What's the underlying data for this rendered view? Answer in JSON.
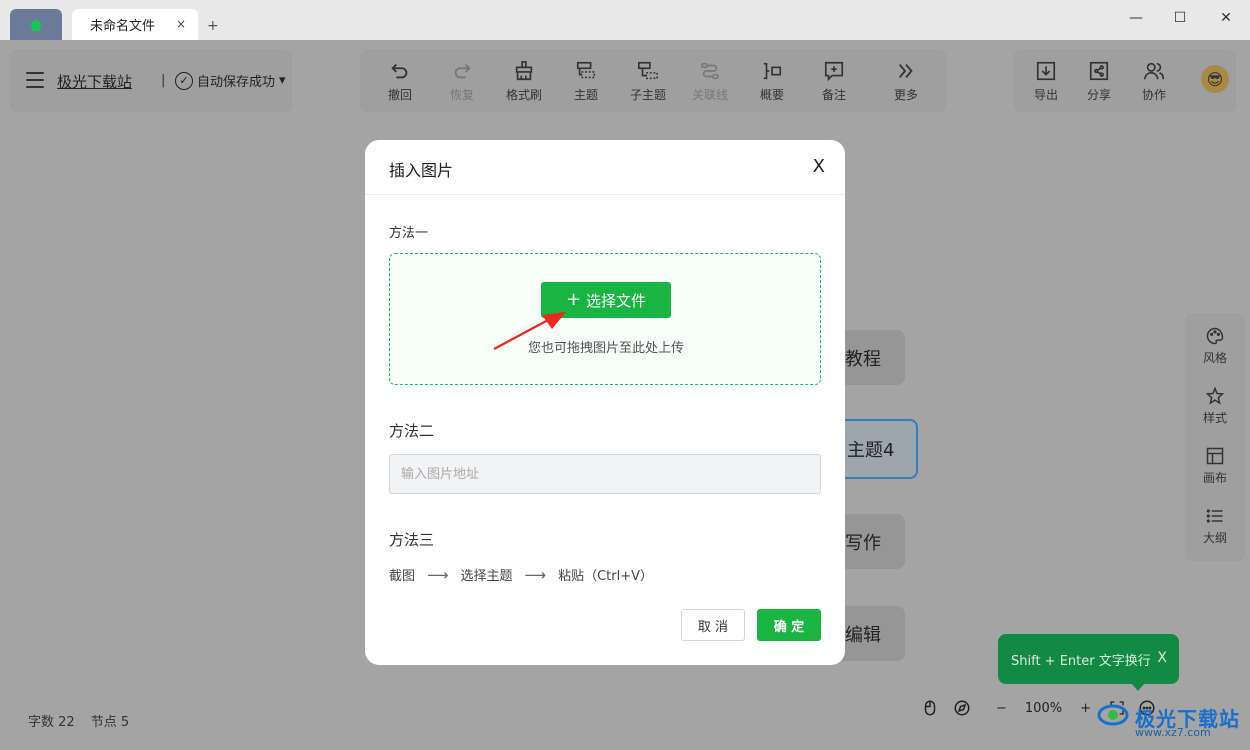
{
  "tabs": {
    "file_tab_label": "未命名文件",
    "close_glyph": "×",
    "new_tab_glyph": "+"
  },
  "window_controls": {
    "minimize": "—",
    "maximize": "☐",
    "close": "✕"
  },
  "header": {
    "site_name": "极光下载站",
    "separator": "|",
    "save_status": "自动保存成功",
    "save_status_dropdown": "▾"
  },
  "toolbar": {
    "items": [
      {
        "label": "撤回",
        "icon": "undo-icon",
        "enabled": true
      },
      {
        "label": "恢复",
        "icon": "redo-icon",
        "enabled": false
      },
      {
        "label": "格式刷",
        "icon": "format-brush-icon",
        "enabled": true
      },
      {
        "label": "主题",
        "icon": "topic-icon",
        "enabled": true
      },
      {
        "label": "子主题",
        "icon": "subtopic-icon",
        "enabled": true
      },
      {
        "label": "关联线",
        "icon": "relation-line-icon",
        "enabled": false
      },
      {
        "label": "概要",
        "icon": "summary-icon",
        "enabled": true
      },
      {
        "label": "备注",
        "icon": "note-icon",
        "enabled": true
      },
      {
        "label": "更多",
        "icon": "more-icon",
        "enabled": true
      }
    ]
  },
  "right_actions": {
    "items": [
      {
        "label": "导出",
        "icon": "export-icon"
      },
      {
        "label": "分享",
        "icon": "share-icon"
      },
      {
        "label": "协作",
        "icon": "collaborate-icon"
      }
    ],
    "avatar": "😎"
  },
  "side_panel": {
    "items": [
      {
        "label": "风格",
        "icon": "palette-icon"
      },
      {
        "label": "样式",
        "icon": "style-icon"
      },
      {
        "label": "画布",
        "icon": "canvas-icon"
      },
      {
        "label": "大纲",
        "icon": "outline-icon"
      }
    ]
  },
  "canvas_nodes": [
    {
      "text": "教程"
    },
    {
      "text": "主题4",
      "selected": true
    },
    {
      "text": "写作"
    },
    {
      "text": "编辑"
    }
  ],
  "tooltip": {
    "text": "Shift + Enter 文字换行",
    "close": "X"
  },
  "status": {
    "word_count_label": "字数",
    "word_count": "22",
    "node_count_label": "节点",
    "node_count": "5"
  },
  "zoom": {
    "minus": "−",
    "level": "100%",
    "plus": "+"
  },
  "watermark": {
    "text": "极光下载站",
    "url": "www.xz7.com"
  },
  "dialog": {
    "title": "插入图片",
    "close": "X",
    "method1": "方法一",
    "choose_file_label": "选择文件",
    "drop_hint": "您也可拖拽图片至此处上传",
    "method2": "方法二",
    "url_placeholder": "输入图片地址",
    "url_value": "",
    "method3": "方法三",
    "steps": [
      "截图",
      "选择主题",
      "粘贴（Ctrl+V）"
    ],
    "step_arrow": "⟶",
    "cancel_label": "取 消",
    "ok_label": "确 定"
  },
  "colors": {
    "accent_green": "#19b442",
    "overlay_bg": "#a4a4a4",
    "tooltip_green": "#128a45",
    "annotation_red": "#e8291f"
  }
}
